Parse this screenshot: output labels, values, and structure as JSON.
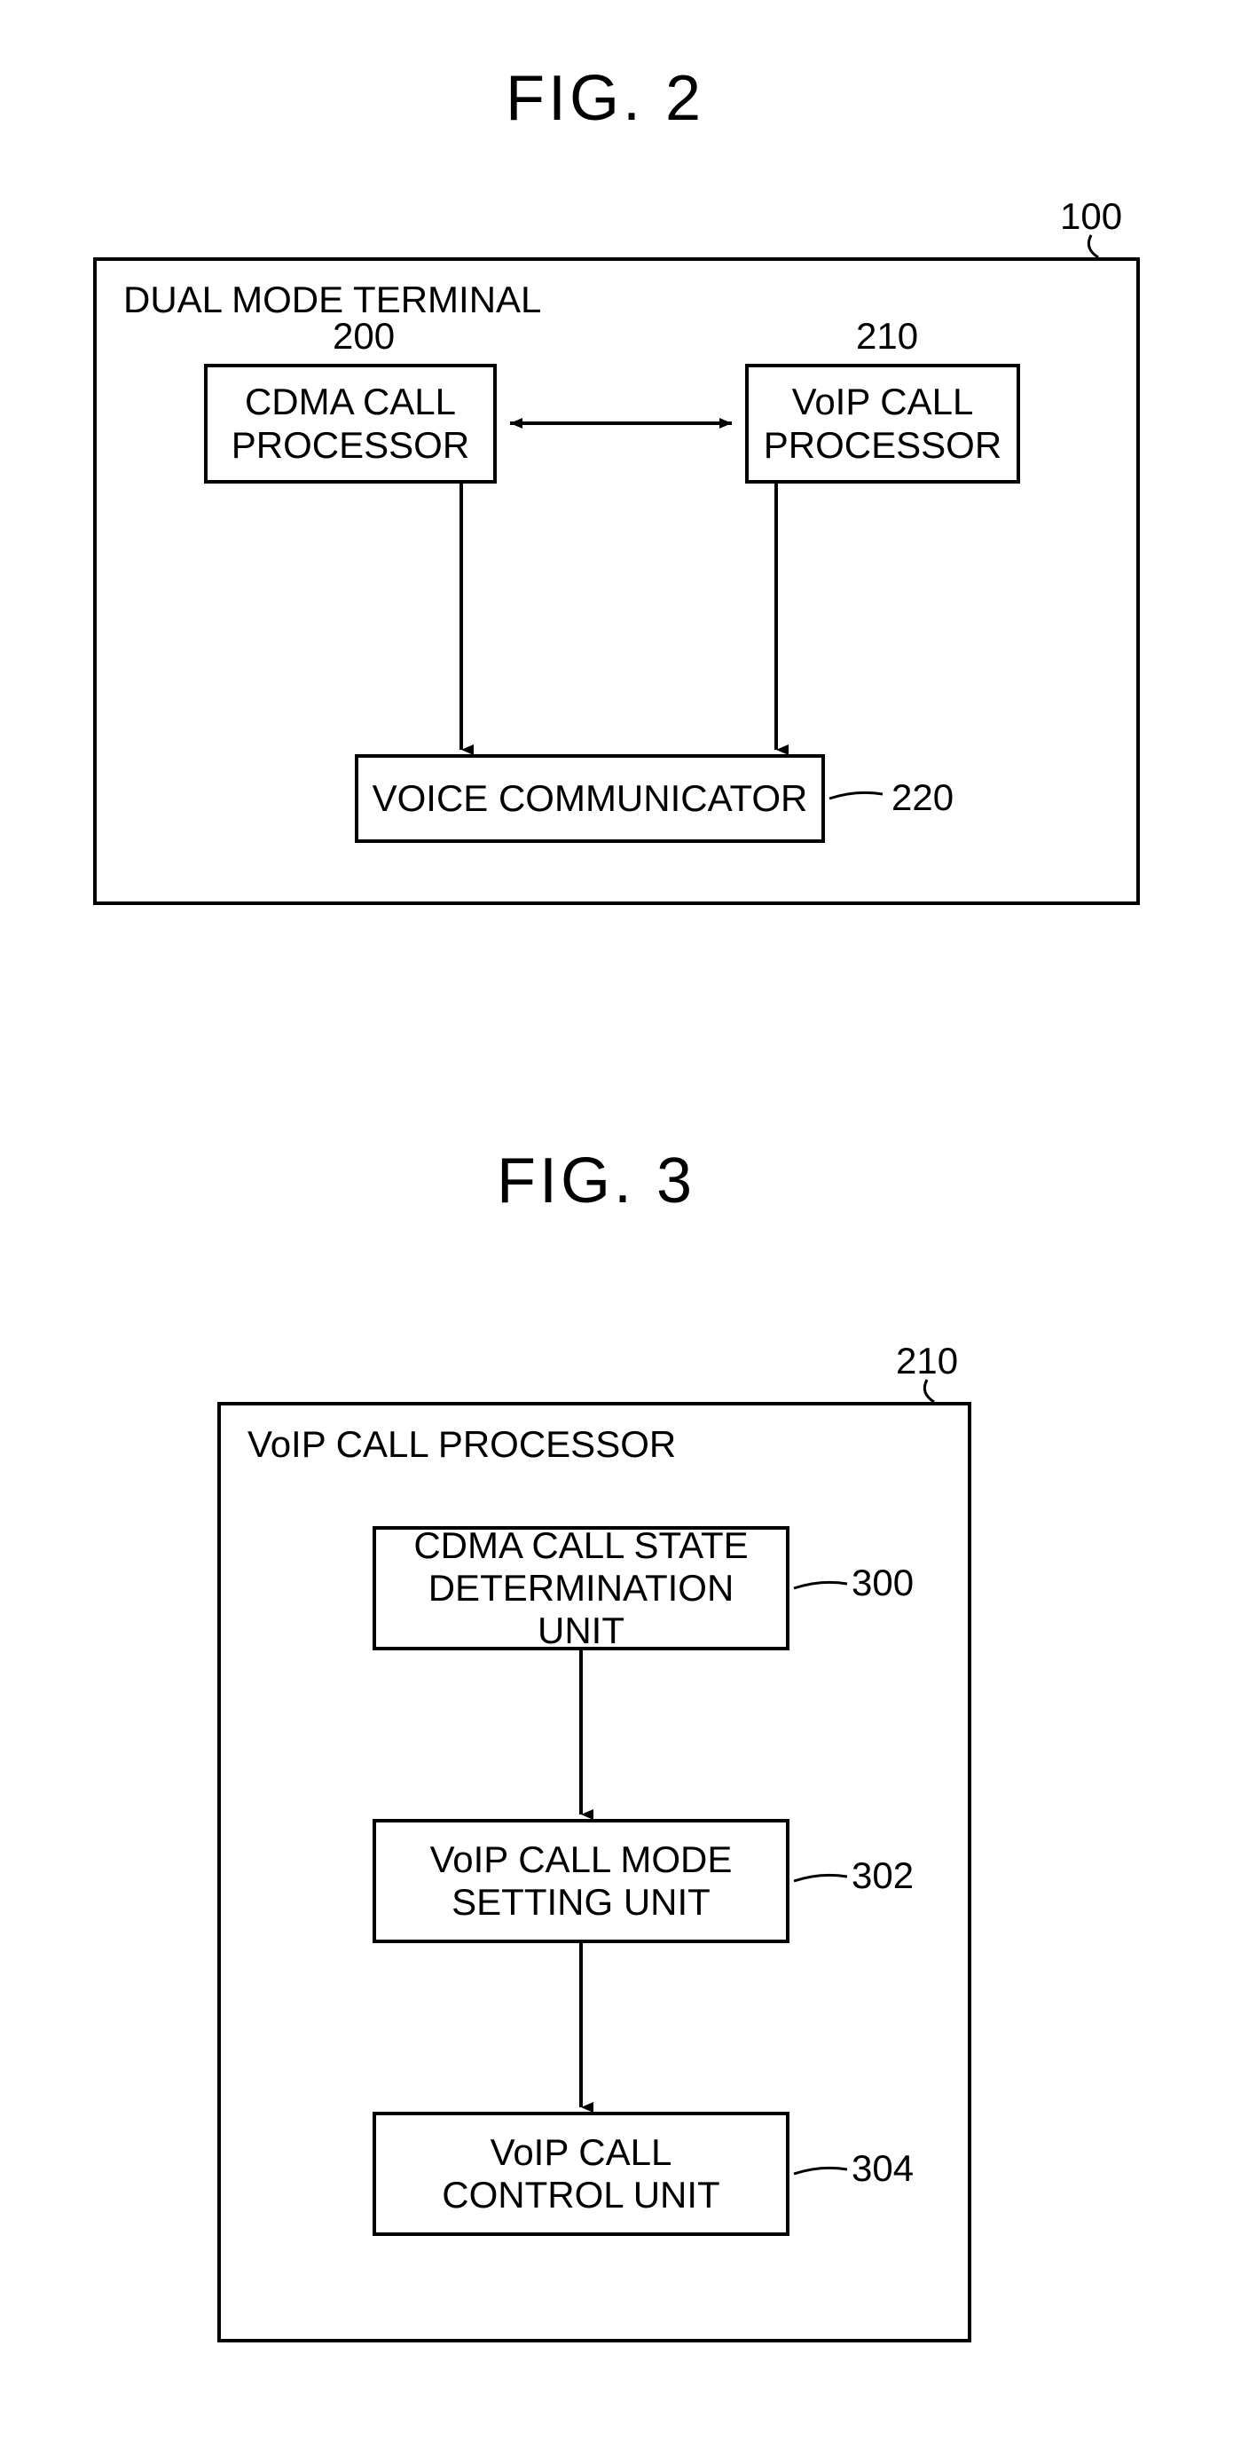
{
  "fig2": {
    "title": "FIG. 2",
    "outer_ref": "100",
    "outer_label": "DUAL MODE TERMINAL",
    "box_cdma": {
      "ref": "200",
      "text": "CDMA CALL\nPROCESSOR"
    },
    "box_voip": {
      "ref": "210",
      "text": "VoIP CALL\nPROCESSOR"
    },
    "box_voice": {
      "ref": "220",
      "text": "VOICE COMMUNICATOR"
    }
  },
  "fig3": {
    "title": "FIG. 3",
    "outer_ref": "210",
    "outer_label": "VoIP CALL PROCESSOR",
    "box_state": {
      "ref": "300",
      "text": "CDMA CALL STATE\nDETERMINATION UNIT"
    },
    "box_mode": {
      "ref": "302",
      "text": "VoIP CALL MODE\nSETTING UNIT"
    },
    "box_ctrl": {
      "ref": "304",
      "text": "VoIP CALL\nCONTROL UNIT"
    }
  }
}
